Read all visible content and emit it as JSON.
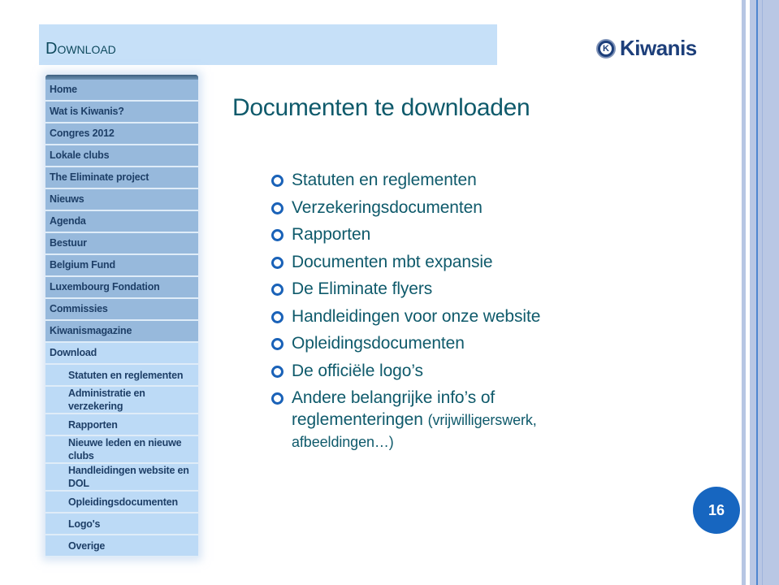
{
  "header": {
    "title": "Download",
    "logo_text": "Kiwanis"
  },
  "sidebar": {
    "items": [
      {
        "label": "Home"
      },
      {
        "label": "Wat is Kiwanis?"
      },
      {
        "label": "Congres 2012"
      },
      {
        "label": "Lokale clubs"
      },
      {
        "label": "The Eliminate project"
      },
      {
        "label": "Nieuws"
      },
      {
        "label": "Agenda"
      },
      {
        "label": "Bestuur"
      },
      {
        "label": "Belgium Fund"
      },
      {
        "label": "Luxembourg Fondation"
      },
      {
        "label": "Commissies"
      },
      {
        "label": "Kiwanismagazine"
      },
      {
        "label": "Download"
      }
    ],
    "sub_items": [
      {
        "label": "Statuten en reglementen"
      },
      {
        "label": "Administratie en verzekering"
      },
      {
        "label": "Rapporten"
      },
      {
        "label": "Nieuwe leden en nieuwe clubs"
      },
      {
        "label": "Handleidingen website en DOL"
      },
      {
        "label": "Opleidingsdocumenten"
      },
      {
        "label": "Logo's"
      },
      {
        "label": "Overige"
      }
    ]
  },
  "main": {
    "title": "Documenten te downloaden",
    "bullets": [
      "Statuten en reglementen",
      "Verzekeringsdocumenten",
      "Rapporten",
      "Documenten mbt expansie",
      "De Eliminate flyers",
      "Handleidingen voor onze website",
      "Opleidingsdocumenten",
      "De officiële logo’s"
    ],
    "last_bullet": {
      "line1": "Andere belangrijke info’s of",
      "line2_main": "reglementeringen",
      "line2_small": "(vrijwilligerswerk,",
      "line3": "afbeeldingen…)"
    }
  },
  "page_number": "16",
  "colors": {
    "accent": "#1766c0",
    "title_text": "#0f5a6b",
    "header_band": "#c6e0f8",
    "nav_bg": "#97b9dc",
    "nav_active_bg": "#bcdaf6"
  }
}
